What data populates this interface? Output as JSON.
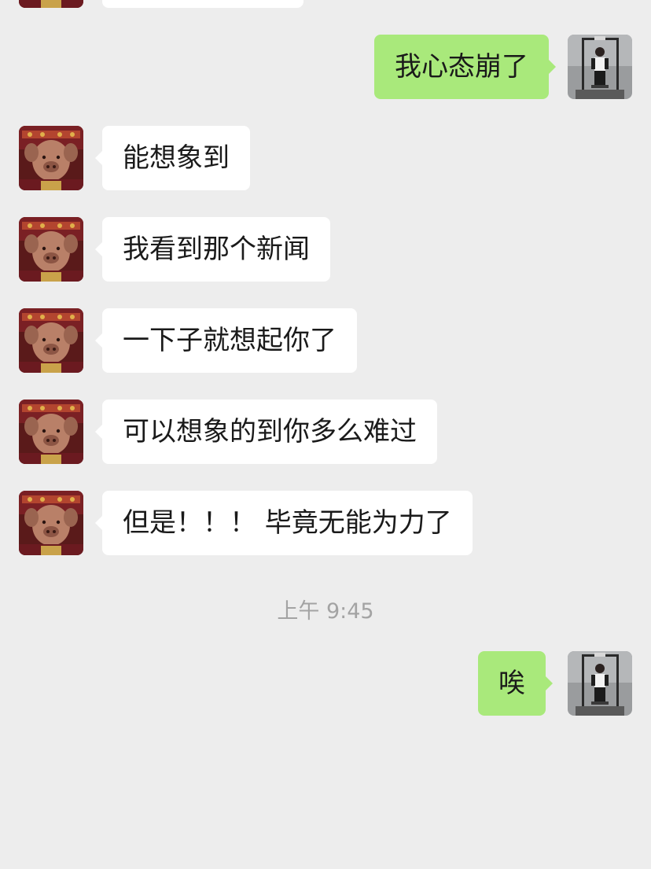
{
  "colors": {
    "background": "#ededed",
    "incoming_bubble": "#ffffff",
    "outgoing_bubble": "#a9e97b",
    "timestamp_text": "#a3a3a3"
  },
  "avatars": {
    "contact": {
      "icon": "costume-portrait-avatar"
    },
    "self": {
      "icon": "gym-photo-avatar"
    }
  },
  "messages": [
    {
      "sender": "self",
      "text": "我心态崩了"
    },
    {
      "sender": "contact",
      "text": "能想象到"
    },
    {
      "sender": "contact",
      "text": "我看到那个新闻"
    },
    {
      "sender": "contact",
      "text": "一下子就想起你了"
    },
    {
      "sender": "contact",
      "text": "可以想象的到你多么难过"
    },
    {
      "sender": "contact",
      "text": "但是！！！ 毕竟无能为力了"
    },
    {
      "type": "timestamp",
      "text": "上午 9:45"
    },
    {
      "sender": "self",
      "text": "唉"
    }
  ]
}
